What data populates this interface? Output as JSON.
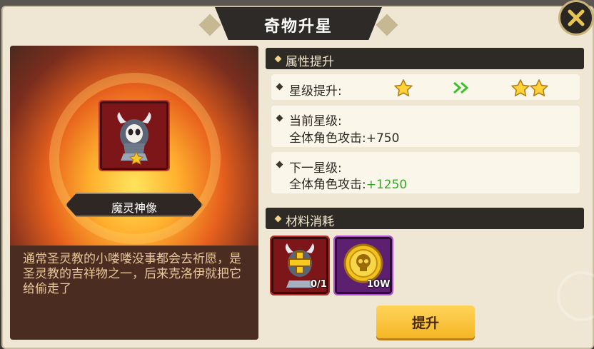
{
  "dialog": {
    "title": "奇物升星"
  },
  "artifact": {
    "name": "魔灵神像",
    "description": "通常圣灵教的小喽喽没事都会去祈愿，是圣灵教的吉祥物之一，后来克洛伊就把它给偷走了",
    "current_stars": 1
  },
  "attributes": {
    "header": "属性提升",
    "star_level_label": "星级提升:",
    "from_stars": 1,
    "to_stars": 2,
    "current_label": "当前星级:",
    "current_stat_label": "全体角色攻击:",
    "current_stat_value": "+750",
    "next_label": "下一星级:",
    "next_stat_label": "全体角色攻击:",
    "next_stat_value": "+1250"
  },
  "materials": {
    "header": "材料消耗",
    "items": [
      {
        "icon": "statue-plus-icon",
        "count": "0/1"
      },
      {
        "icon": "skull-coin-icon",
        "count": "10W"
      }
    ]
  },
  "actions": {
    "upgrade_label": "提升"
  },
  "colors": {
    "accent_green": "#35a82a",
    "button": "#f4b625",
    "panel": "#efe7d4",
    "header": "#2e2a25"
  }
}
